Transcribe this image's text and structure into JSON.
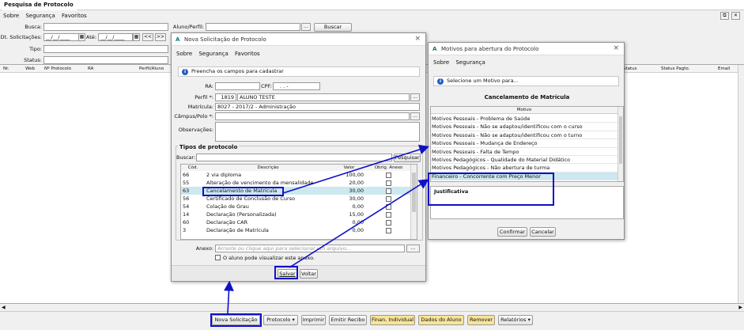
{
  "colors": {
    "accent": "#1010c8",
    "selection": "#cce8f0",
    "button_yellow": "#f8e49a"
  },
  "main": {
    "tab_title": "Pesquisa de Protocolo",
    "tab_close": "×",
    "menu": [
      "Sobre",
      "Segurança",
      "Favoritos"
    ],
    "labels": {
      "busca": "Busca:",
      "dt": "Dt. Solicitações:",
      "ate": "Até:",
      "tipo": "Tipo:",
      "status": "Status:",
      "aluno": "Aluno/Perfil:"
    },
    "date_from": "__/__/____",
    "date_to": "__/__/____",
    "nav_prev": "<<",
    "nav_next": ">>",
    "dots": "...",
    "buscar_label": "Buscar",
    "columns_left": [
      "Nr.",
      "Web",
      "Nº Protocolo",
      "RA",
      "Perfil/Aluno"
    ],
    "columns_right": [
      "Status",
      "Status Pagto.",
      "Email"
    ],
    "bottom_buttons": {
      "nova": "Nova Solicitação",
      "protocolo": "Protocolo",
      "imprimir": "Imprimir",
      "emitir": "Emitir Recibo",
      "financ": "Finan. Individual",
      "dados": "Dados do Aluno",
      "remover": "Remover",
      "relatorios": "Relatórios"
    }
  },
  "nova": {
    "title": "Nova Solicitação de Protocolo",
    "logo": "A",
    "close": "×",
    "menu": [
      "Sobre",
      "Segurança",
      "Favoritos"
    ],
    "info": "Preencha os campos para cadastrar",
    "info_icon": "i",
    "labels": {
      "ra": "RA:",
      "cpf": "CPF:",
      "perfil": "Perfil *:",
      "matricula": "Matrícula:",
      "campus": "Câmpus/Polo *:",
      "obs": "Observações:"
    },
    "cpf_mask": ".   .   -",
    "perfil_code": "1819",
    "perfil_name": "ALUNO TESTE",
    "matricula_value": "8027 - 2017/2 - Administração",
    "dots": "...",
    "tipos_title": "Tipos de protocolo",
    "buscar_label": "Buscar:",
    "pesquisar": "Pesquisar",
    "columns": [
      "Cód.",
      "Descrição",
      "Valor",
      "Obrig. Anexo"
    ],
    "rows": [
      {
        "cod": "66",
        "desc": "2 via diploma",
        "valor": "100,00"
      },
      {
        "cod": "55",
        "desc": "Alteração de vencimento da mensalidade",
        "valor": "20,00"
      },
      {
        "cod": "63",
        "desc": "Cancelamento de Matrícula",
        "valor": "30,00"
      },
      {
        "cod": "56",
        "desc": "Certificado de Conclusão de Curso",
        "valor": "30,00"
      },
      {
        "cod": "54",
        "desc": "Colação de Grau",
        "valor": "0,00"
      },
      {
        "cod": "14",
        "desc": "Declaração (Personalizada)",
        "valor": "15,00"
      },
      {
        "cod": "60",
        "desc": "Declaração CAR",
        "valor": "0,00"
      },
      {
        "cod": "3",
        "desc": "Declaração de Matrícula",
        "valor": "0,00"
      }
    ],
    "anexo_label": "Anexo:",
    "anexo_placeholder": "Arraste ou clique aqui para selecionar um arquivo...",
    "aluno_visualizar": "O aluno pode visualizar este anexo.",
    "salvar": "Salvar",
    "voltar": "Voltar"
  },
  "motivos": {
    "title": "Motivos para abertura do Protocolo",
    "logo": "A",
    "close": "×",
    "menu": [
      "Sobre",
      "Segurança"
    ],
    "info": "Selecione um Motivo para...",
    "info_icon": "i",
    "heading": "Cancelamento de Matrícula",
    "column": "Motivo",
    "items": [
      "Motivos Pessoais - Problema de Saúde",
      "Motivos Pessoais - Não se adaptou/identificou com o curso",
      "Motivos Pessoais - Não se adaptou/identificou com o turno",
      "Motivos Pessoais - Mudança de Endereço",
      "Motivos Pessoais - Falta de Tempo",
      "Motivos Pedagógicos - Qualidade do Material Didático",
      "Motivos Pedagógicos - Não abertura de turma",
      "Financeiro - Concorrente com Preço Menor"
    ],
    "justificativa": "Justificativa",
    "confirmar": "Confirmar",
    "cancelar": "Cancelar"
  }
}
